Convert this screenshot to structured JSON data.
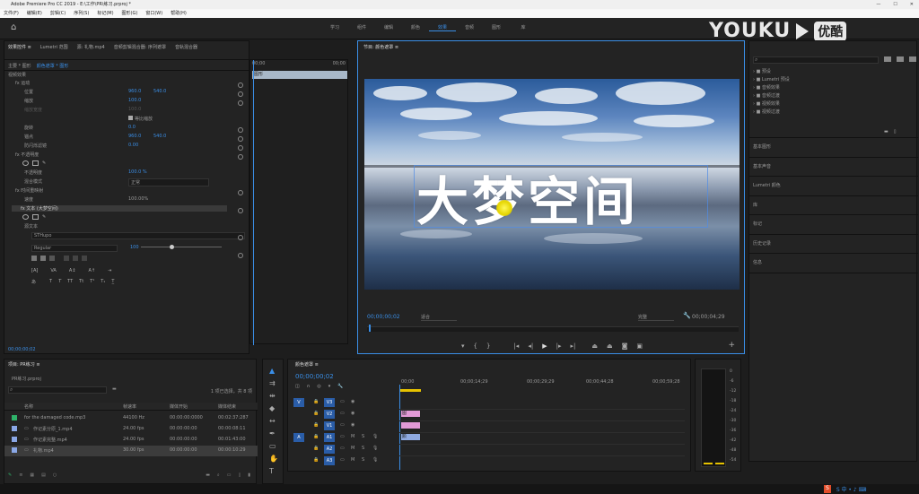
{
  "window": {
    "title": "Adobe Premiere Pro CC 2019 - E:\\工作\\PR\\练习.prproj *",
    "minimize": "—",
    "maximize": "☐",
    "close": "✕"
  },
  "menu": [
    "文件(F)",
    "编辑(E)",
    "剪辑(C)",
    "序列(S)",
    "标记(M)",
    "图形(G)",
    "窗口(W)",
    "帮助(H)"
  ],
  "workspace_tabs": [
    "学习",
    "组件",
    "编辑",
    "颜色",
    "效果",
    "音频",
    "图形",
    "库"
  ],
  "workspace_active_index": 4,
  "watermark": {
    "brand": "YOUKU",
    "cn": "优酷"
  },
  "effect_controls": {
    "tabs": [
      "效果控件 ≡",
      "Lumetri 范围",
      "源: 礼物.mp4",
      "音频剪辑混合器: 序列遮罩",
      "音轨混合器"
    ],
    "source": "主要 * 图形",
    "sequence": "颜色遮罩 * 图形",
    "timecode_start": "00;00",
    "timecode_end": "00;00",
    "clip_label": "图形",
    "section": "视频效果",
    "rows": [
      {
        "label": "fx 运动"
      },
      {
        "label": "位置",
        "v1": "960.0",
        "v2": "540.0"
      },
      {
        "label": "缩放",
        "v1": "100.0"
      },
      {
        "label": "缩放宽度",
        "v1": "100.0"
      },
      {
        "label": "等比缩放"
      },
      {
        "label": "旋转",
        "v1": "0.0"
      },
      {
        "label": "锚点",
        "v1": "960.0",
        "v2": "540.0"
      },
      {
        "label": "防闪烁滤镜",
        "v1": "0.00"
      },
      {
        "label": "fx 不透明度"
      },
      {
        "label": "不透明度",
        "v1": "100.0 %"
      },
      {
        "label": "混合模式",
        "v1": "正常"
      },
      {
        "label": "fx 时间重映射"
      },
      {
        "label": "速度",
        "v1": "100.00%"
      },
      {
        "label": "fx 文本 (大梦空间)"
      },
      {
        "label": "源文本"
      }
    ],
    "font": "STHupo",
    "font_style": "Regular",
    "font_size": "100",
    "bottom_time": "00;00;00;02"
  },
  "program": {
    "title": "节目: 颜色遮罩 ≡",
    "overlay_text": "大梦空间",
    "timecode": "00;00;00;02",
    "fit": "适合",
    "quality": "完整",
    "duration": "00;00;04;29"
  },
  "effects_panel": {
    "search_placeholder": "",
    "tree": [
      "预设",
      "Lumetri 预设",
      "音频效果",
      "音频过渡",
      "视频效果",
      "视频过渡"
    ],
    "sections": [
      "基本图形",
      "基本声音",
      "Lumetri 颜色",
      "库",
      "标记",
      "历史记录",
      "信息"
    ]
  },
  "project": {
    "tabs": [
      "项目: PR练习 ≡"
    ],
    "name": "PR练习.prproj",
    "count": "1 项已选择，共 8 项",
    "columns": [
      "名称",
      "帧速率",
      "媒体开始",
      "媒体结束"
    ],
    "rows": [
      {
        "color": "#2fb36a",
        "name": "for the damaged code.mp3",
        "fps": "44100 Hz",
        "start": "00:00:00:0000",
        "end": "00:02:37:287"
      },
      {
        "color": "#8aa7e6",
        "name": "作记素分原_1.mp4",
        "fps": "24.00 fps",
        "start": "00:00:00:00",
        "end": "00:00:08:11"
      },
      {
        "color": "#8aa7e6",
        "name": "作记素完整.mp4",
        "fps": "24.00 fps",
        "start": "00:00:00:00",
        "end": "00:01:43:00"
      },
      {
        "color": "#8aa7e6",
        "name": "礼物.mp4",
        "fps": "30.00 fps",
        "start": "00:00:00:00",
        "end": "00:00:10:29"
      }
    ]
  },
  "timeline": {
    "title": "颜色遮罩 ≡",
    "timecode": "00;00;00;02",
    "ruler": [
      "00;00",
      "00;00;14;29",
      "00;00;29;29",
      "00;00;44;28",
      "00;00;59;28"
    ],
    "video_tracks": [
      "V3",
      "V2",
      "V1"
    ],
    "audio_tracks": [
      "A1",
      "A2",
      "A3"
    ],
    "clip_v3_label": "图",
    "clip_v2_label": "",
    "clip_v1_label": "颜"
  },
  "meter": {
    "scale": [
      "0",
      "-6",
      "-12",
      "-18",
      "-24",
      "-30",
      "-36",
      "-42",
      "-48",
      "-54"
    ],
    "lr": [
      "S",
      "S"
    ]
  },
  "taskbar": {
    "label": "S 中 • ♪ ⌨"
  }
}
